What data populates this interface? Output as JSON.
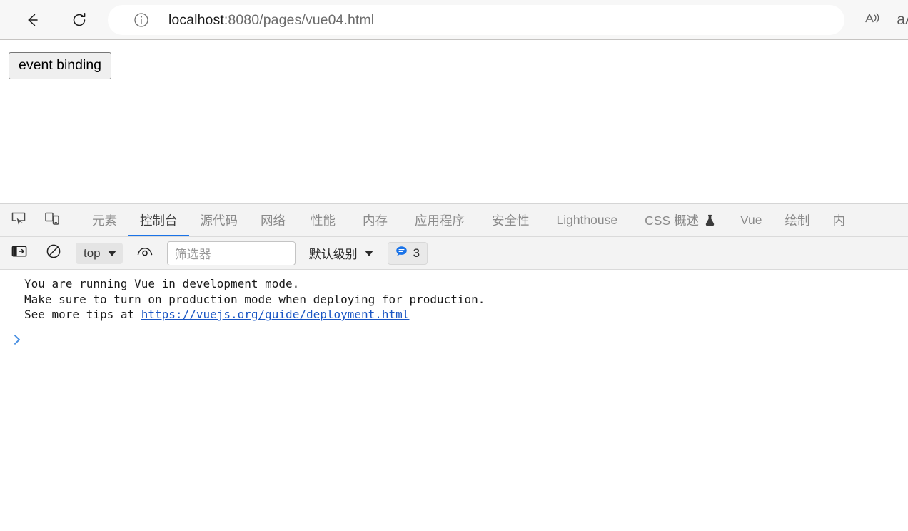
{
  "browser": {
    "back_icon": "back-arrow-icon",
    "reload_icon": "reload-icon",
    "info_icon": "site-info-icon",
    "url_host": "localhost",
    "url_path": ":8080/pages/vue04.html",
    "read_aloud_icon": "read-aloud-icon",
    "text_size_label": "aA"
  },
  "page": {
    "button_label": "event binding"
  },
  "devtools": {
    "inspect_icon": "inspect-element-icon",
    "device_toolbar_icon": "device-toolbar-icon",
    "tabs": [
      {
        "label": "元素",
        "active": false
      },
      {
        "label": "控制台",
        "active": true
      },
      {
        "label": "源代码",
        "active": false
      },
      {
        "label": "网络",
        "active": false
      },
      {
        "label": "性能",
        "active": false
      },
      {
        "label": "内存",
        "active": false
      },
      {
        "label": "应用程序",
        "active": false
      },
      {
        "label": "安全性",
        "active": false
      },
      {
        "label": "Lighthouse",
        "active": false
      },
      {
        "label": "CSS 概述",
        "active": false,
        "icon": "flask-icon"
      },
      {
        "label": "Vue",
        "active": false
      },
      {
        "label": "绘制",
        "active": false
      },
      {
        "label": "内",
        "active": false
      }
    ],
    "console_toolbar": {
      "sidebar_toggle_icon": "console-sidebar-toggle-icon",
      "clear_console_icon": "clear-console-icon",
      "context_label": "top",
      "live_expression_icon": "eye-icon",
      "filter_placeholder": "筛选器",
      "filter_value": "",
      "level_label": "默认级别",
      "message_badge_icon": "speech-bubble-icon",
      "message_count": "3"
    },
    "console_messages": [
      {
        "line1": "You are running Vue in development mode.",
        "line2": "Make sure to turn on production mode when deploying for production.",
        "line3_prefix": "See more tips at ",
        "link": "https://vuejs.org/guide/deployment.html"
      }
    ],
    "prompt_symbol": "❯"
  },
  "colors": {
    "accent_blue": "#1a73e8",
    "link_blue": "#1a56c4",
    "prompt_blue": "#4a90e2",
    "chrome_bg": "#f7f7f7",
    "devtools_bg": "#f3f3f3"
  }
}
